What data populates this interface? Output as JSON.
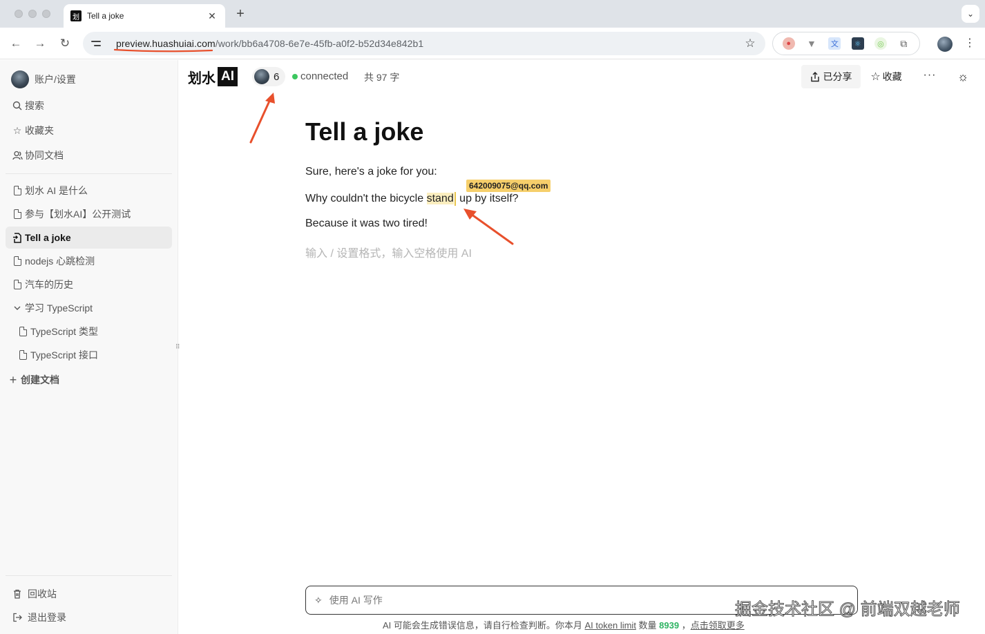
{
  "browser": {
    "tab_title": "Tell a joke",
    "tab_favicon_char": "划",
    "tab_close": "✕",
    "new_tab": "+",
    "tab_menu": "⌄",
    "url_host": "preview.huashuiai.com",
    "url_path": "/work/bb6a4708-6e7e-45fb-a0f2-b52d34e842b1",
    "back": "←",
    "forward": "→",
    "reload": "↻",
    "bookmark_star": "☆",
    "kebab": "⋮"
  },
  "sidebar": {
    "account_label": "账户/设置",
    "top_items": [
      {
        "label": "搜索",
        "icon": "search-icon"
      },
      {
        "label": "收藏夹",
        "icon": "star-icon"
      },
      {
        "label": "协同文档",
        "icon": "users-icon"
      }
    ],
    "docs": [
      {
        "label": "划水 AI 是什么"
      },
      {
        "label": "参与【划水AI】公开测试"
      },
      {
        "label": "Tell a joke",
        "active": true
      },
      {
        "label": "nodejs 心跳检测"
      },
      {
        "label": "汽车的历史"
      }
    ],
    "folder": {
      "label": "学习 TypeScript",
      "children": [
        {
          "label": "TypeScript 类型"
        },
        {
          "label": "TypeScript 接口"
        }
      ]
    },
    "create_doc": "创建文档",
    "trash": "回收站",
    "logout": "退出登录"
  },
  "header": {
    "logo_text": "划水",
    "logo_badge": "AI",
    "online_count": "6",
    "status": "connected",
    "word_count": "共 97 字",
    "share_label": "已分享",
    "favorite_label": "收藏",
    "more": "···",
    "theme_icon": "☼"
  },
  "document": {
    "title": "Tell a joke",
    "para1": "Sure, here's a joke for you:",
    "para2_before": "Why couldn't the bicycle ",
    "para2_highlight": "stand",
    "para2_after": " up by itself?",
    "para3": "Because it was two tired!",
    "placeholder": "输入 / 设置格式，输入空格使用 AI",
    "collaborator_tag": "642009075@qq.com"
  },
  "ai_bar": {
    "placeholder": "使用 AI 写作",
    "note_prefix": "AI 可能会生成错误信息，请自行检查判断。你本月 ",
    "note_link": "AI token limit",
    "note_mid": " 数量 ",
    "note_number": "8939",
    "note_sep": " ，",
    "note_cta": "点击领取更多"
  },
  "watermark": "掘金技术社区 @ 前端双越老师",
  "colors": {
    "highlight": "#fbeebf",
    "collab_tag": "#f6cf6b",
    "connected_dot": "#3cc75f",
    "annotation_arrow": "#e8502c"
  }
}
